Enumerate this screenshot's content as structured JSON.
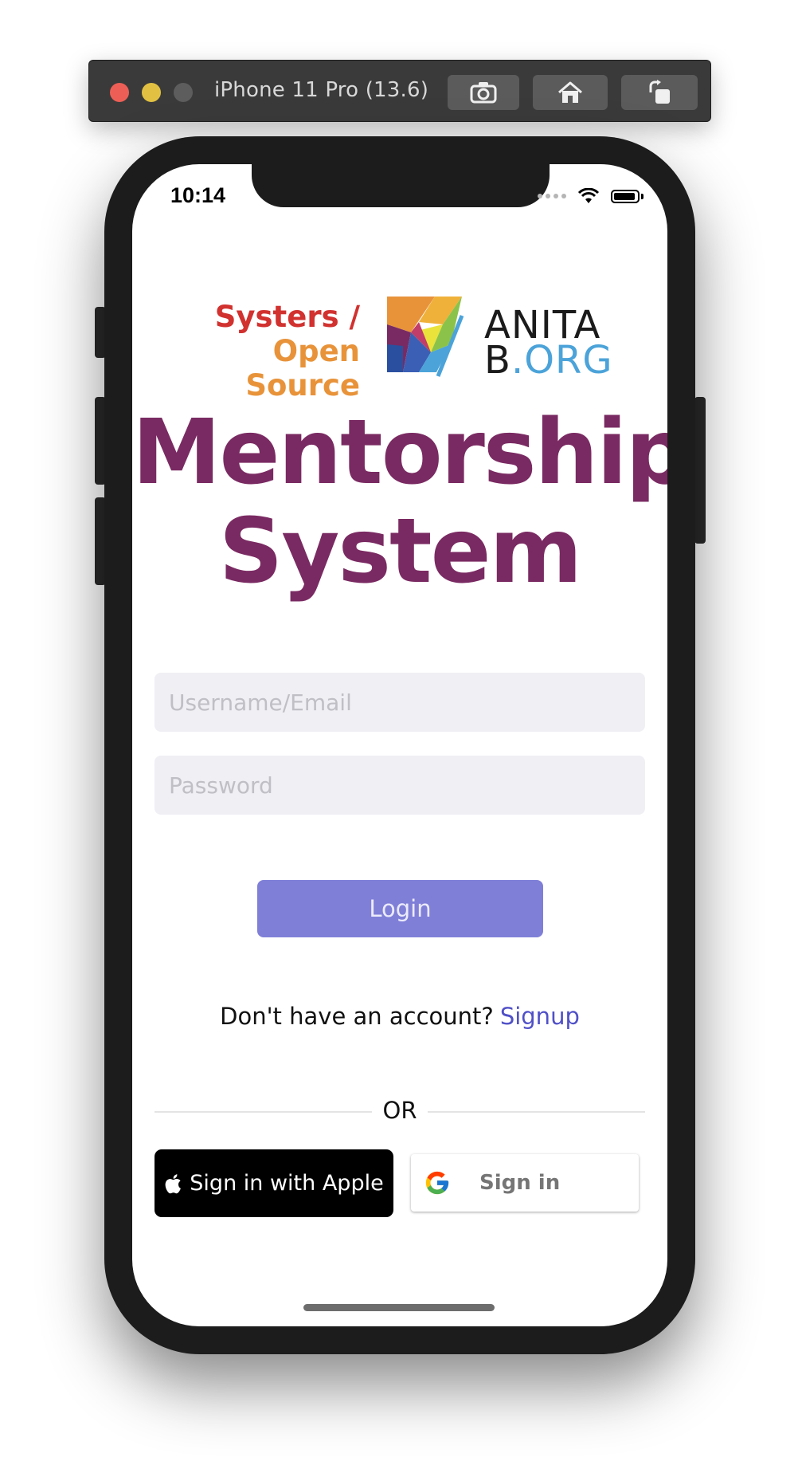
{
  "simulator": {
    "title": "iPhone 11 Pro (13.6)",
    "icons": [
      "screenshot-icon",
      "home-icon",
      "rotate-icon"
    ]
  },
  "status_bar": {
    "time": "10:14"
  },
  "logo": {
    "systers_line1": "Systers /",
    "systers_line2": "Open Source",
    "anita_line1": "ANITA",
    "anita_line2_b": "B",
    "anita_line2_org": ".ORG"
  },
  "app": {
    "title_line1": "Mentorship",
    "title_line2": "System"
  },
  "login_form": {
    "username_placeholder": "Username/Email",
    "password_placeholder": "Password",
    "login_label": "Login"
  },
  "signup": {
    "prompt": "Don't have an account?",
    "link": "Signup"
  },
  "divider": {
    "label": "OR"
  },
  "social": {
    "apple_label": "Sign in with Apple",
    "google_label": "Sign in"
  },
  "colors": {
    "brand": "#7a2a62",
    "login_button": "#7f7fd8",
    "link": "#5050c8",
    "systers_red": "#d1312f",
    "systers_orange": "#e8933a",
    "anita_blue": "#4ba3d9"
  }
}
